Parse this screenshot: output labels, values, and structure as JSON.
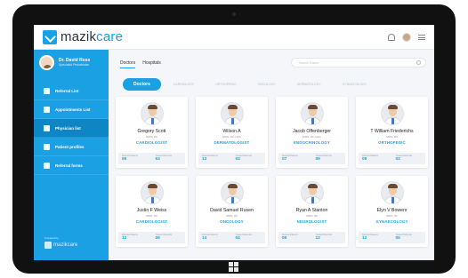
{
  "app": {
    "logo_part1": "mazik",
    "logo_part2": "care"
  },
  "user": {
    "name": "Dr. David Ross",
    "subtitle": "Specialist Pediatrician"
  },
  "nav": [
    {
      "label": "Referral List",
      "icon": "list-icon"
    },
    {
      "label": "Appointments List",
      "icon": "calendar-icon"
    },
    {
      "label": "Physician list",
      "icon": "physician-icon",
      "active": true
    },
    {
      "label": "Patient profiles",
      "icon": "patient-icon"
    },
    {
      "label": "Referral forms",
      "icon": "form-icon"
    }
  ],
  "footer": {
    "powered": "Powered by",
    "brand": "mazikcare"
  },
  "tabs": [
    "Doctors",
    "Hospitals"
  ],
  "search": {
    "placeholder": "Search Doctor"
  },
  "specialties": [
    "Doctors",
    "CARDIOLOGY",
    "ORTHOPEDIC",
    "ONCOLOGY",
    "DERMATOLOGY",
    "GYNAECOLOGY"
  ],
  "stat_labels": {
    "referral": "Referral Patients",
    "treated": "Treated Referrals"
  },
  "doctors": [
    {
      "name": "Gregory Scott",
      "degree": "MBBS, MD",
      "specialty": "CARDIOLOGIST",
      "referral": "59",
      "treated": "53"
    },
    {
      "name": "Wilson A",
      "degree": "MBBS, MD (GEN)",
      "specialty": "DERMATOLOGIST",
      "referral": "13",
      "treated": "03"
    },
    {
      "name": "Jacob Offenberger",
      "degree": "MBBS, MD (GEN)",
      "specialty": "ENDOCRINOLOGY",
      "referral": "07",
      "treated": "09"
    },
    {
      "name": "T William Friederichs",
      "degree": "MBBS, MD",
      "specialty": "ORTHOPEDIC",
      "referral": "09",
      "treated": "02"
    },
    {
      "name": "Justin F Weiss",
      "degree": "MBBS, MD",
      "specialty": "CARDIOLOGIST",
      "referral": "12",
      "treated": "09"
    },
    {
      "name": "David Samuel Rusen",
      "degree": "MBBS, MD",
      "specialty": "ONCOLOGY",
      "referral": "14",
      "treated": "04"
    },
    {
      "name": "Ryan A Stanton",
      "degree": "MBBS, MD",
      "specialty": "NEUROLOGIST",
      "referral": "09",
      "treated": "12"
    },
    {
      "name": "Elyn V Bowers",
      "degree": "MBBS, MD",
      "specialty": "GYNAECOLOGY",
      "referral": "12",
      "treated": "05"
    }
  ]
}
